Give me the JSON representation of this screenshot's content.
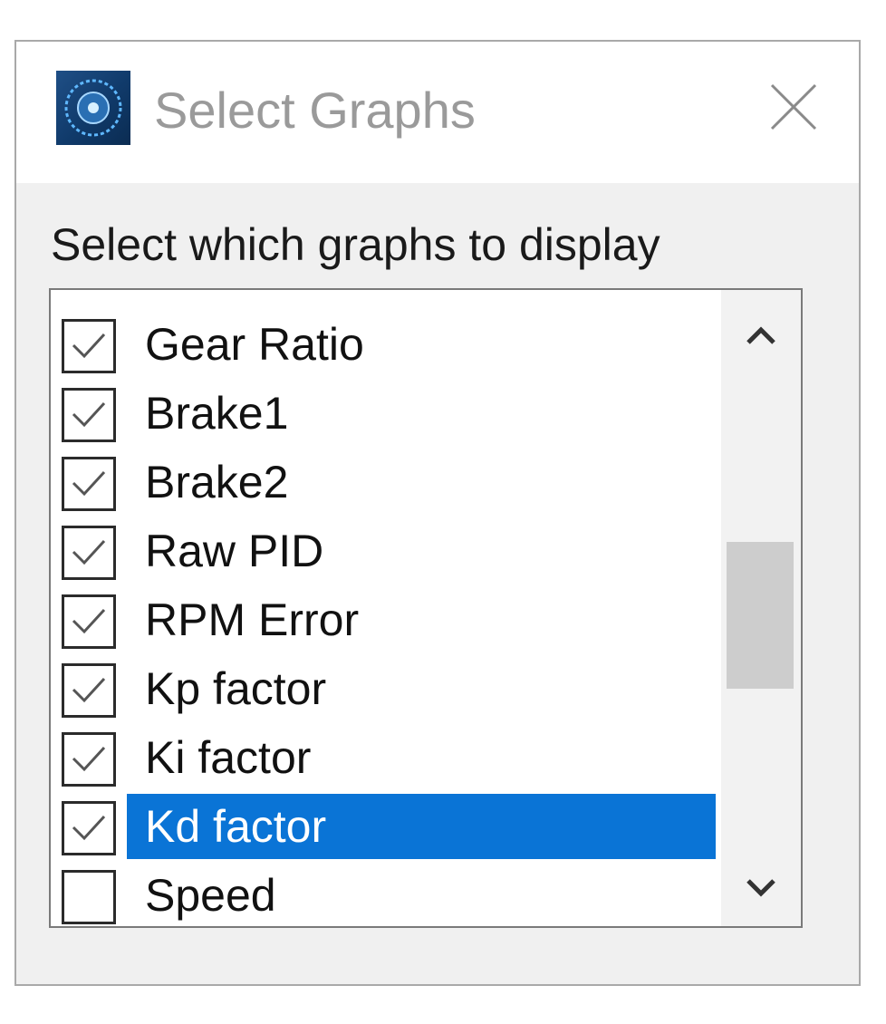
{
  "window": {
    "title": "Select Graphs",
    "icon": "app-icon",
    "close_icon": "close-icon"
  },
  "prompt": "Select which graphs to display",
  "list": {
    "items": [
      {
        "label": "Gear Ratio",
        "checked": true,
        "selected": false
      },
      {
        "label": "Brake1",
        "checked": true,
        "selected": false
      },
      {
        "label": "Brake2",
        "checked": true,
        "selected": false
      },
      {
        "label": "Raw PID",
        "checked": true,
        "selected": false
      },
      {
        "label": "RPM Error",
        "checked": true,
        "selected": false
      },
      {
        "label": "Kp factor",
        "checked": true,
        "selected": false
      },
      {
        "label": "Ki factor",
        "checked": true,
        "selected": false
      },
      {
        "label": "Kd factor",
        "checked": true,
        "selected": true
      },
      {
        "label": "Speed",
        "checked": false,
        "selected": false
      }
    ]
  },
  "colors": {
    "selection": "#0a74d6",
    "titlebar_bg": "#ffffff",
    "dialog_bg": "#f0f0f0",
    "title_text": "#9a9a9a"
  }
}
